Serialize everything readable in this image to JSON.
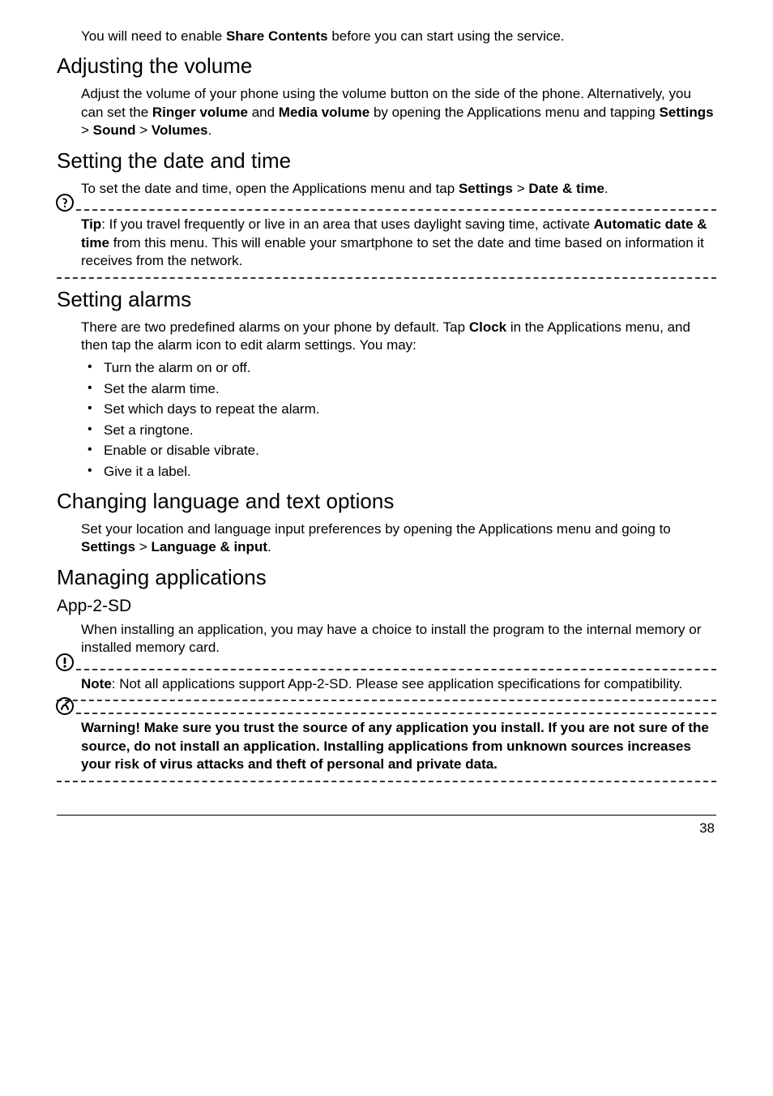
{
  "intro": {
    "prefix": "You will need to enable ",
    "bold": "Share Contents",
    "suffix": " before you can start using the service."
  },
  "sections": {
    "adjust_volume": {
      "heading": "Adjusting the volume",
      "p1_a": "Adjust the volume of your phone using the volume button on the side of the phone. Alternatively, you can set the ",
      "p1_b1": "Ringer volume",
      "p1_c": " and ",
      "p1_b2": "Media volume",
      "p1_d": " by opening the Applications menu and tapping ",
      "p1_b3": "Settings",
      "p1_e": " > ",
      "p1_b4": "Sound",
      "p1_f": " > ",
      "p1_b5": "Volumes",
      "p1_g": "."
    },
    "date_time": {
      "heading": "Setting the date and time",
      "p1_a": "To set the date and time, open the Applications menu and tap ",
      "p1_b1": "Settings",
      "p1_c": " > ",
      "p1_b2": "Date & time",
      "p1_d": ".",
      "tip_label": "Tip",
      "tip_a": ": If you travel frequently or live in an area that uses daylight saving time, activate ",
      "tip_b": "Automatic date & time",
      "tip_c": " from this menu. This will enable your smartphone to set the date and time based on information it receives from the network."
    },
    "alarms": {
      "heading": "Setting alarms",
      "p1_a": "There are two predefined alarms on your phone by default. Tap ",
      "p1_b": "Clock",
      "p1_c": " in the Applications menu, and then tap the alarm icon to edit alarm settings. You may:",
      "items": [
        "Turn the alarm on or off.",
        "Set the alarm time.",
        "Set which days to repeat the alarm.",
        "Set a ringtone.",
        "Enable or disable vibrate.",
        "Give it a label."
      ]
    },
    "lang": {
      "heading": "Changing language and text options",
      "p1_a": "Set your location and language input preferences by opening the Applications menu and going to ",
      "p1_b1": "Settings",
      "p1_c": " > ",
      "p1_b2": "Language & input",
      "p1_d": "."
    },
    "apps": {
      "heading": "Managing applications",
      "sub": "App-2-SD",
      "p1": "When installing an application, you may have a choice to install the program to the internal memory or installed memory card.",
      "note_label": "Note",
      "note_text": ": Not all applications support App-2-SD. Please see application specifications for compatibility.",
      "warn_text": "Warning! Make sure you trust the source of any application you install. If you are not sure of the source, do not install an application. Installing applications from unknown sources increases your risk of virus attacks and theft of personal and private data."
    }
  },
  "page_number": "38"
}
